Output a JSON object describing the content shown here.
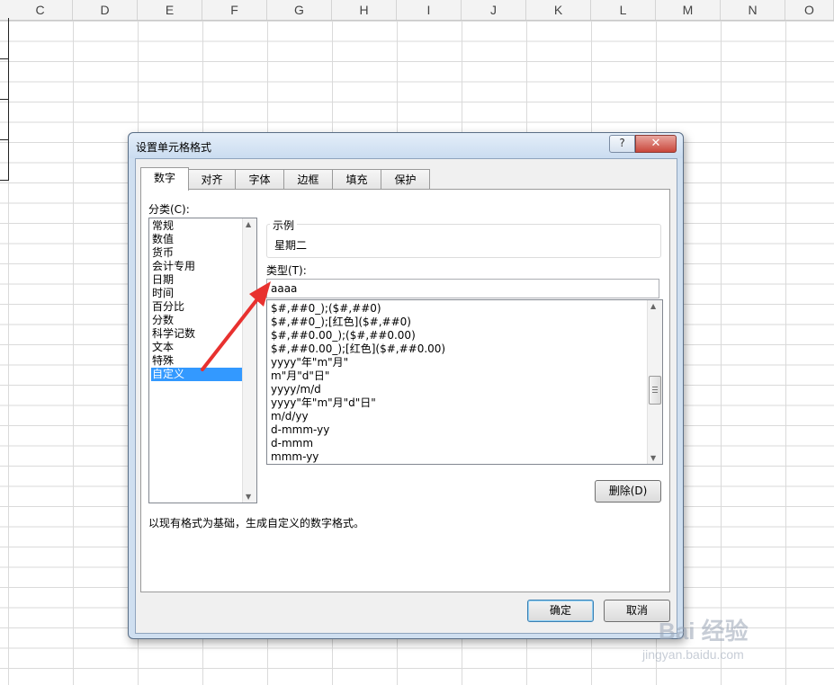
{
  "spreadsheet": {
    "columns": [
      "C",
      "D",
      "E",
      "F",
      "G",
      "H",
      "I",
      "J",
      "K",
      "L",
      "M",
      "N",
      "O"
    ]
  },
  "dialog": {
    "title": "设置单元格格式",
    "help_label": "?",
    "close_label": "✕",
    "tabs": [
      {
        "label": "数字",
        "active": true
      },
      {
        "label": "对齐"
      },
      {
        "label": "字体"
      },
      {
        "label": "边框"
      },
      {
        "label": "填充"
      },
      {
        "label": "保护"
      }
    ],
    "category_label": "分类(C):",
    "categories": [
      "常规",
      "数值",
      "货币",
      "会计专用",
      "日期",
      "时间",
      "百分比",
      "分数",
      "科学记数",
      "文本",
      "特殊",
      "自定义"
    ],
    "selected_category": "自定义",
    "sample_legend": "示例",
    "sample_value": "星期二",
    "type_label": "类型(T):",
    "type_value": "aaaa",
    "formats": [
      "$#,##0_);($#,##0)",
      "$#,##0_);[红色]($#,##0)",
      "$#,##0.00_);($#,##0.00)",
      "$#,##0.00_);[红色]($#,##0.00)",
      "yyyy\"年\"m\"月\"",
      "m\"月\"d\"日\"",
      "yyyy/m/d",
      "yyyy\"年\"m\"月\"d\"日\"",
      "m/d/yy",
      "d-mmm-yy",
      "d-mmm",
      "mmm-yy"
    ],
    "delete_label": "删除(D)",
    "description": "以现有格式为基础，生成自定义的数字格式。",
    "ok_label": "确定",
    "cancel_label": "取消"
  },
  "annotation": {
    "arrow_color": "#e8312f"
  },
  "watermark": {
    "brand": "Bai 经验",
    "url": "jingyan.baidu.com"
  }
}
